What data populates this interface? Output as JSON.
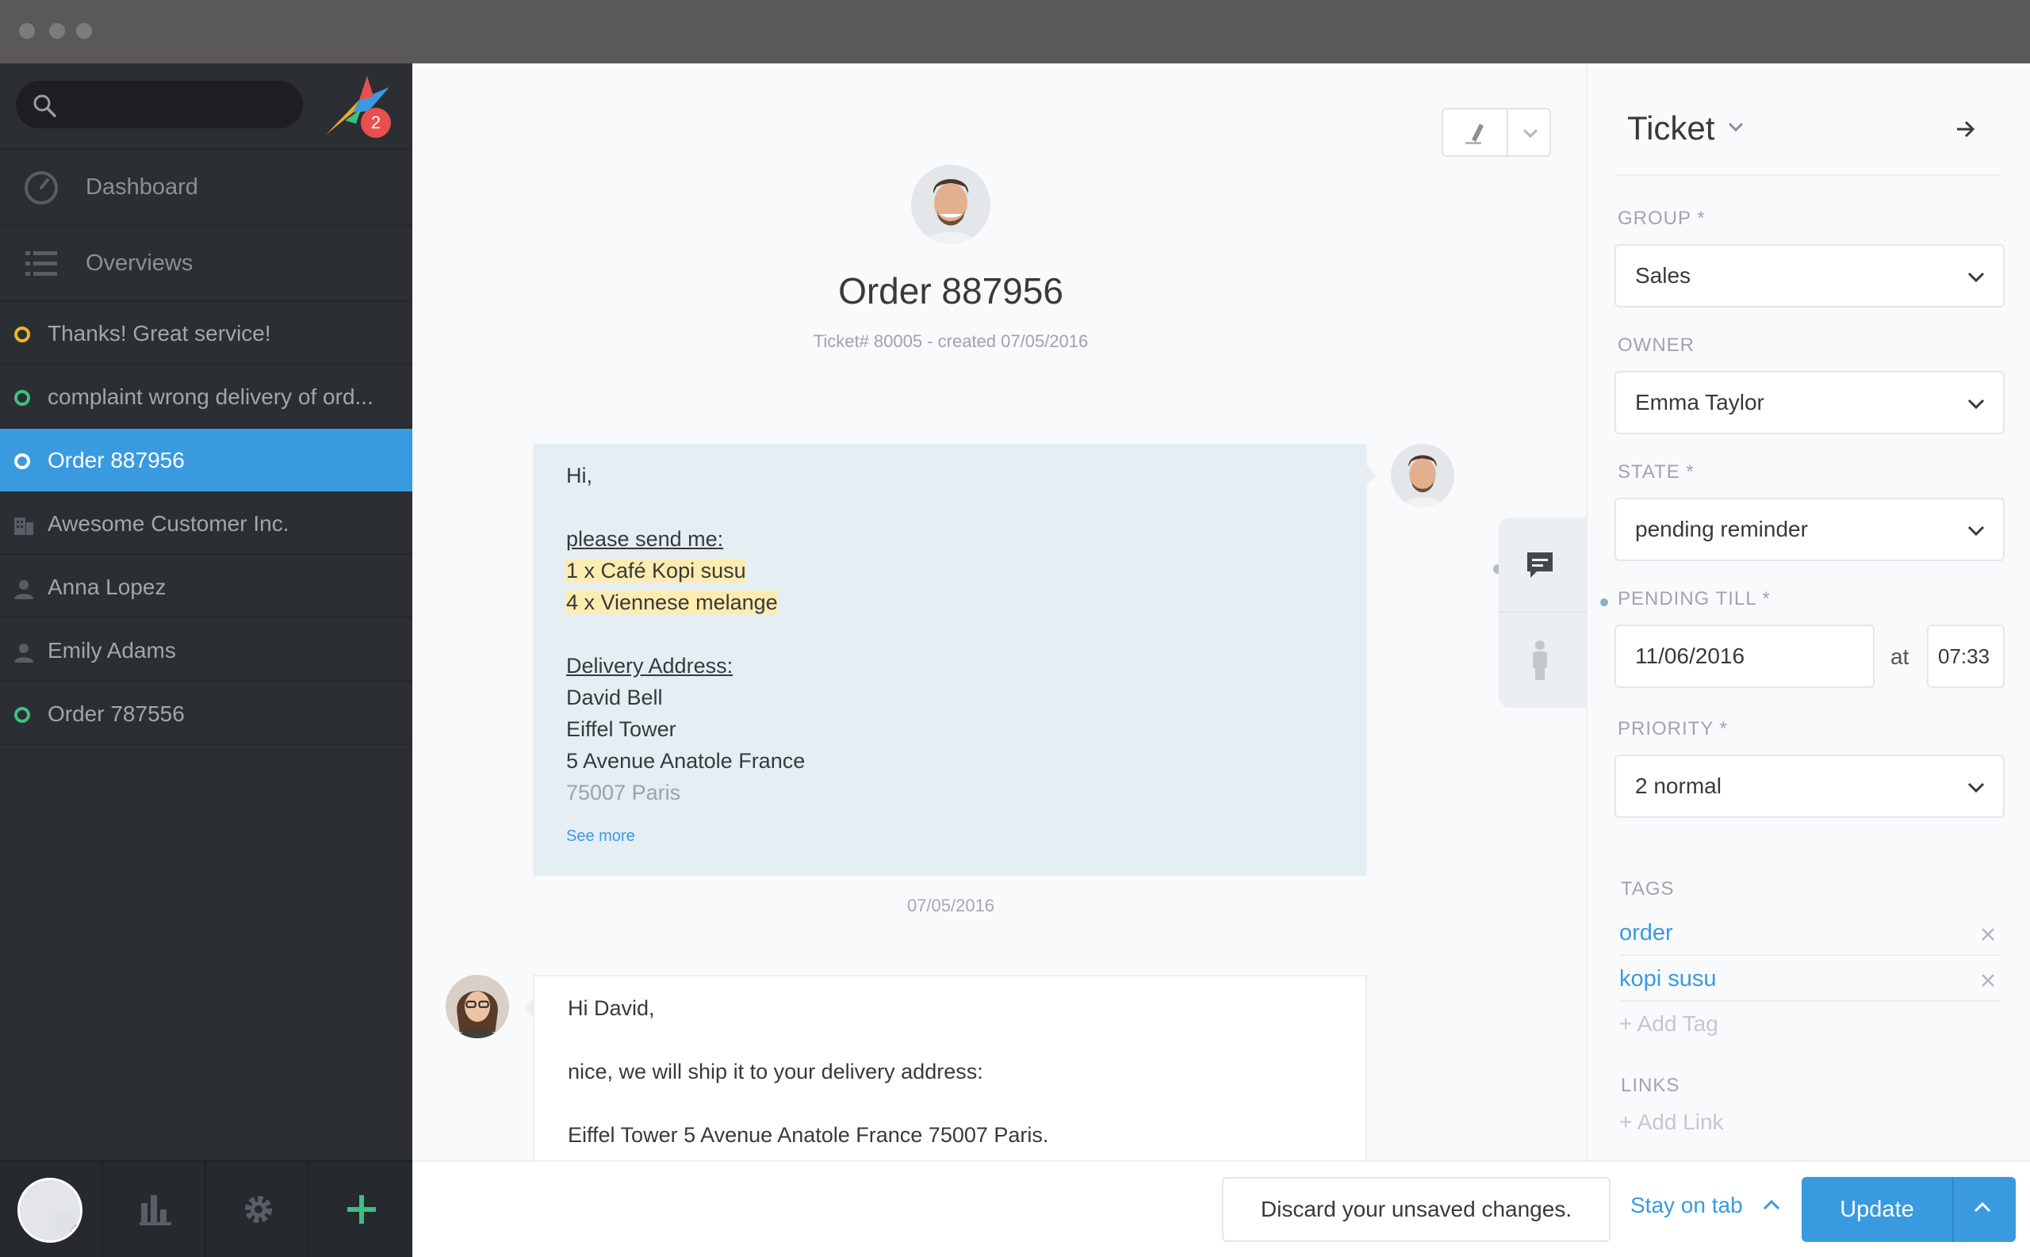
{
  "sidebar": {
    "search_placeholder": "",
    "notification_count": "2",
    "nav": [
      {
        "label": "Dashboard",
        "icon": "dashboard-icon"
      },
      {
        "label": "Overviews",
        "icon": "list-icon"
      }
    ],
    "tasks": [
      {
        "label": "Thanks! Great service!",
        "icon": "ticket-open-icon",
        "color": "#f0b429"
      },
      {
        "label": "complaint wrong delivery of ord...",
        "icon": "ticket-open-icon",
        "color": "#3fbf7f"
      },
      {
        "label": "Order 887956",
        "icon": "ticket-open-icon",
        "color": "#ffffff"
      },
      {
        "label": "Awesome Customer Inc.",
        "icon": "organization-icon"
      },
      {
        "label": "Anna Lopez",
        "icon": "user-icon"
      },
      {
        "label": "Emily Adams",
        "icon": "user-icon"
      },
      {
        "label": "Order 787556",
        "icon": "ticket-open-icon",
        "color": "#3fbf7f"
      }
    ]
  },
  "ticket": {
    "title": "Order 887956",
    "meta": "Ticket# 80005 - created 07/05/2016",
    "messages": [
      {
        "lines": [
          "Hi,",
          "",
          "please send me:",
          "1 x Café Kopi susu",
          "4 x Viennese melange",
          "",
          "Delivery Address:",
          "David Bell",
          "Eiffel Tower",
          "5 Avenue Anatole France",
          "75007 Paris"
        ],
        "see_more": "See more",
        "date": "07/05/2016"
      },
      {
        "lines": [
          "Hi David,",
          "",
          "nice, we will ship it to your delivery address:",
          "",
          "Eiffel Tower 5 Avenue Anatole France 75007 Paris."
        ]
      }
    ]
  },
  "panel": {
    "title": "Ticket",
    "group": {
      "label": "GROUP *",
      "value": "Sales"
    },
    "owner": {
      "label": "OWNER",
      "value": "Emma Taylor"
    },
    "state": {
      "label": "STATE *",
      "value": "pending reminder"
    },
    "pending": {
      "label": "PENDING TILL *",
      "date": "11/06/2016",
      "at": "at",
      "time": "07:33"
    },
    "priority": {
      "label": "PRIORITY *",
      "value": "2 normal"
    },
    "tags": {
      "label": "TAGS",
      "items": [
        "order",
        "kopi susu"
      ],
      "add": "+ Add Tag"
    },
    "links": {
      "label": "LINKS",
      "add": "+ Add Link"
    }
  },
  "bottom": {
    "discard": "Discard your unsaved changes.",
    "stay": "Stay on tab",
    "update": "Update"
  },
  "colors": {
    "accent": "#3a9ae0",
    "sidebar": "#2b2e33"
  }
}
